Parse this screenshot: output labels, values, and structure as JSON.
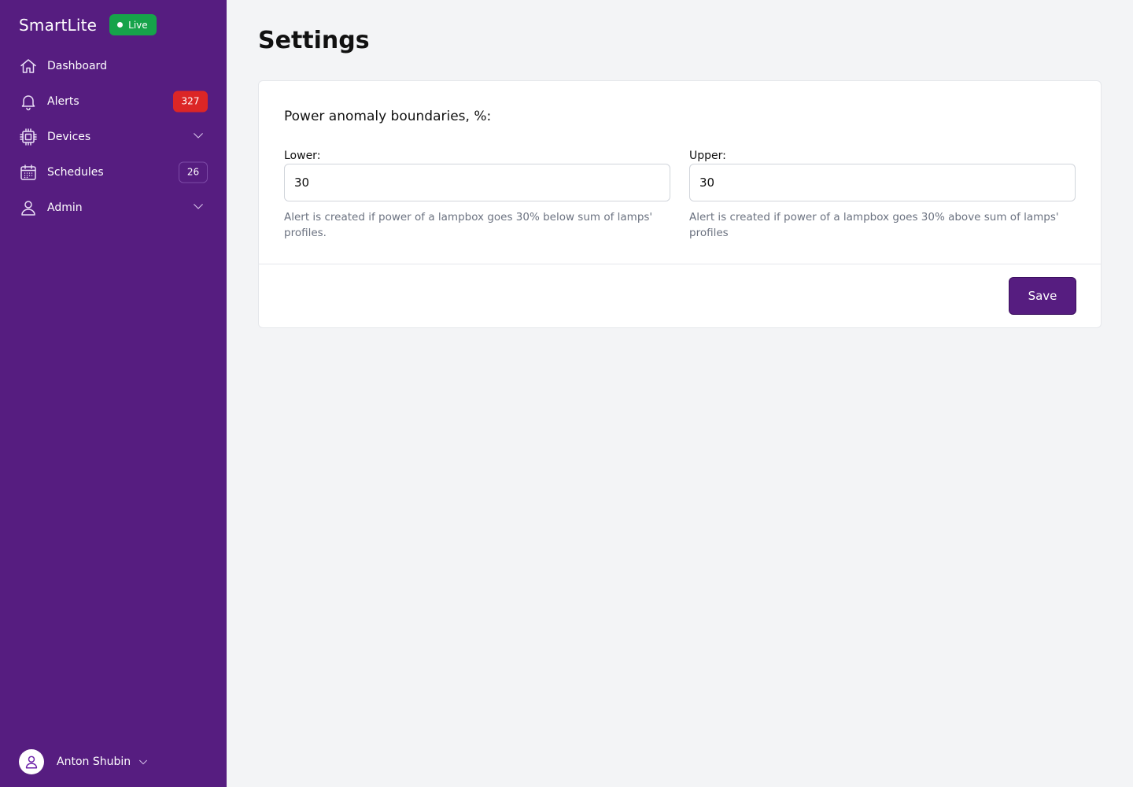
{
  "app": {
    "name": "SmartLite",
    "status_label": "Live"
  },
  "sidebar": {
    "items": [
      {
        "label": "Dashboard",
        "icon": "home-icon"
      },
      {
        "label": "Alerts",
        "icon": "bell-icon",
        "badge": "327"
      },
      {
        "label": "Devices",
        "icon": "chip-icon",
        "expandable": true
      },
      {
        "label": "Schedules",
        "icon": "calendar-icon",
        "badge": "26"
      },
      {
        "label": "Admin",
        "icon": "user-icon",
        "expandable": true
      }
    ],
    "user": {
      "name": "Anton Shubin"
    }
  },
  "page": {
    "title": "Settings"
  },
  "settings": {
    "section_title": "Power anomaly boundaries, %:",
    "lower": {
      "label": "Lower:",
      "value": "30",
      "help": "Alert is created if power of a lampbox goes 30% below sum of lamps' profiles."
    },
    "upper": {
      "label": "Upper:",
      "value": "30",
      "help": "Alert is created if power of a lampbox goes 30% above sum of lamps' profiles"
    },
    "save_label": "Save"
  },
  "colors": {
    "sidebar_bg": "#561d80",
    "live_badge": "#16a34a",
    "alert_badge": "#dc2626",
    "primary_button": "#561d80"
  }
}
